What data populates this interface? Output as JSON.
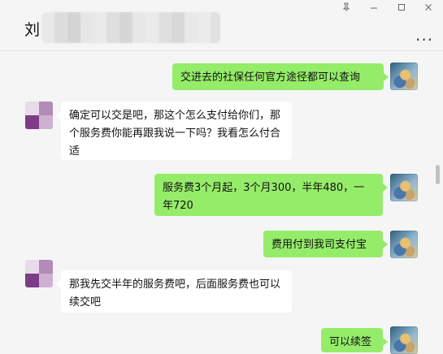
{
  "header": {
    "title": "刘",
    "pin_icon": "pin-icon",
    "minimize_icon": "minimize-icon",
    "maximize_icon": "maximize-icon",
    "close_icon": "close-icon",
    "more_label": "..."
  },
  "messages": [
    {
      "side": "right",
      "text": "交进去的社保任何官方途径都可以查询"
    },
    {
      "side": "left",
      "text": "确定可以交是吧，那这个怎么支付给你们，那个服务费你能再跟我说一下吗？我看怎么付合适"
    },
    {
      "side": "right",
      "text": "服务费3个月起，3个月300，半年480，一年720"
    },
    {
      "side": "right",
      "text": "费用付到我司支付宝"
    },
    {
      "side": "left",
      "text": "那我先交半年的服务费吧，后面服务费也可以续交吧"
    },
    {
      "side": "right",
      "text": "可以续签"
    }
  ]
}
